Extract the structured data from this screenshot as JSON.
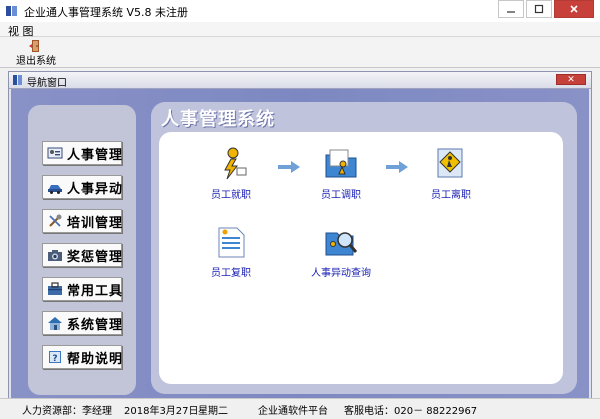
{
  "window": {
    "title": "企业通人事管理系统 V5.8   未注册"
  },
  "menu": {
    "view_label": "视 图"
  },
  "toolbar": {
    "exit_label": "退出系统"
  },
  "nav_window": {
    "title": "导航窗口"
  },
  "header": {
    "system_title": "人事管理系统"
  },
  "left_menu": [
    {
      "label": "人事管理",
      "icon": "id-card-icon"
    },
    {
      "label": "人事异动",
      "icon": "car-icon"
    },
    {
      "label": "培训管理",
      "icon": "tools-icon"
    },
    {
      "label": "奖惩管理",
      "icon": "camera-icon"
    },
    {
      "label": "常用工具",
      "icon": "toolbox-icon"
    },
    {
      "label": "系统管理",
      "icon": "house-icon"
    },
    {
      "label": "帮助说明",
      "icon": "help-book-icon"
    }
  ],
  "features": {
    "onboard": "员工就职",
    "transfer": "员工调职",
    "leave": "员工离职",
    "rehire": "员工复职",
    "change_query": "人事异动查询"
  },
  "status": {
    "department": "人力资源部：李经理",
    "date": "2018年3月27日",
    "weekday": "星期二",
    "platform": "企业通软件平台",
    "hotline": "客服电话：020－ 88222967"
  }
}
